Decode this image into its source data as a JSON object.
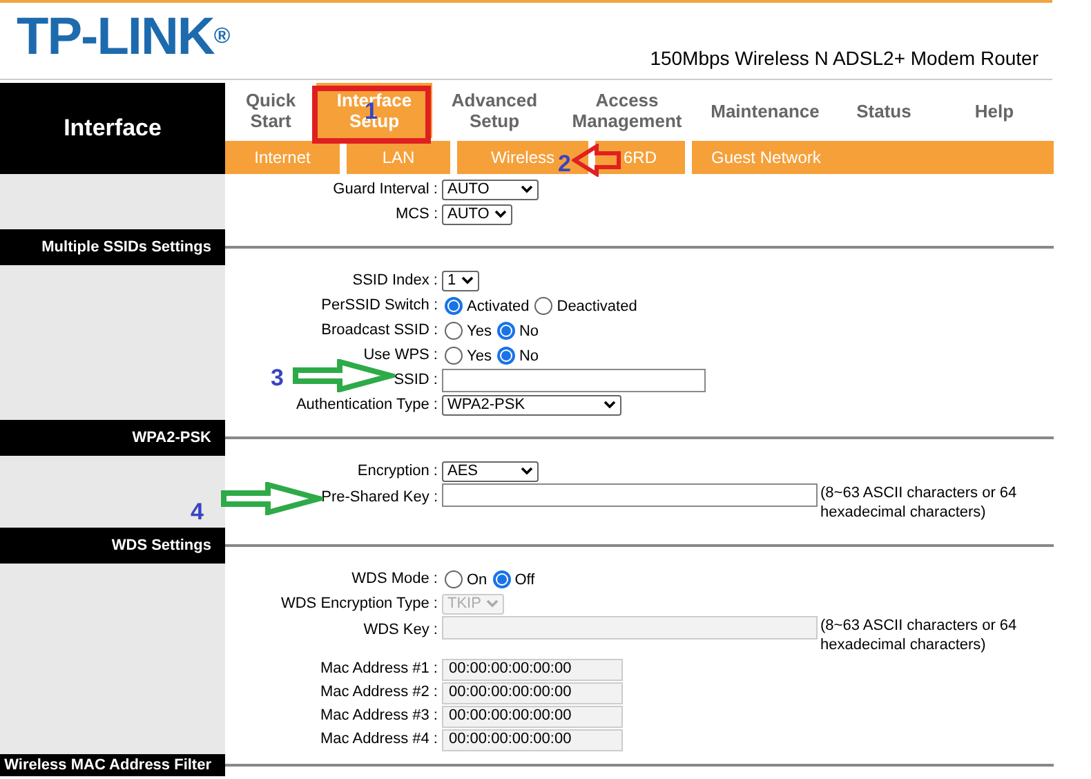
{
  "header": {
    "logo": "TP-LINK",
    "logo_mark": "®",
    "product": "150Mbps Wireless N ADSL2+ Modem Router"
  },
  "nav": {
    "section": "Interface",
    "tabs": [
      {
        "label": "Quick\nStart",
        "selected": false
      },
      {
        "label": "Interface\nSetup",
        "selected": true
      },
      {
        "label": "Advanced\nSetup",
        "selected": false
      },
      {
        "label": "Access\nManagement",
        "selected": false
      },
      {
        "label": "Maintenance",
        "selected": false
      },
      {
        "label": "Status",
        "selected": false
      },
      {
        "label": "Help",
        "selected": false
      }
    ],
    "subtabs": [
      {
        "label": "Internet"
      },
      {
        "label": "LAN"
      },
      {
        "label": "Wireless"
      },
      {
        "label": "6RD"
      },
      {
        "label": "Guest Network"
      }
    ]
  },
  "sections": [
    {
      "rows": [
        {
          "kind": "select",
          "label": "Guard Interval :",
          "value": "AUTO",
          "disabled": false,
          "wide": true
        },
        {
          "kind": "select",
          "label": "MCS :",
          "value": "AUTO",
          "disabled": false
        }
      ]
    },
    {
      "title": "Multiple SSIDs Settings",
      "rows": [
        {
          "kind": "select",
          "label": "SSID Index :",
          "value": "1",
          "disabled": false
        },
        {
          "kind": "radio",
          "label": "PerSSID Switch :",
          "options": [
            {
              "label": "Activated",
              "selected": true
            },
            {
              "label": "Deactivated",
              "selected": false
            }
          ]
        },
        {
          "kind": "radio",
          "label": "Broadcast SSID :",
          "options": [
            {
              "label": "Yes",
              "selected": false
            },
            {
              "label": "No",
              "selected": true
            }
          ]
        },
        {
          "kind": "radio",
          "label": "Use WPS :",
          "options": [
            {
              "label": "Yes",
              "selected": false
            },
            {
              "label": "No",
              "selected": true
            }
          ]
        },
        {
          "kind": "text",
          "label": "SSID :",
          "value": "",
          "disabled": false
        },
        {
          "kind": "select",
          "label": "Authentication Type :",
          "value": "WPA2-PSK",
          "disabled": false,
          "wide": true
        }
      ]
    },
    {
      "title": "WPA2-PSK",
      "rows": [
        {
          "kind": "select",
          "label": "Encryption :",
          "value": "AES",
          "disabled": false,
          "wide": true
        },
        {
          "kind": "key",
          "label": "Pre-Shared Key :",
          "value": "",
          "disabled": false,
          "note": "(8~63 ASCII characters or 64 hexadecimal characters)"
        }
      ]
    },
    {
      "title": "WDS Settings",
      "rows": [
        {
          "kind": "radio",
          "label": "WDS Mode :",
          "options": [
            {
              "label": "On",
              "selected": false
            },
            {
              "label": "Off",
              "selected": true
            }
          ]
        },
        {
          "kind": "select",
          "label": "WDS Encryption Type :",
          "value": "TKIP",
          "disabled": true
        },
        {
          "kind": "key",
          "label": "WDS Key :",
          "value": "",
          "disabled": true,
          "note": "(8~63 ASCII characters or 64 hexadecimal characters)"
        },
        {
          "kind": "mac",
          "label": "Mac Address #1 :",
          "value": "00:00:00:00:00:00",
          "disabled": true
        },
        {
          "kind": "mac",
          "label": "Mac Address #2 :",
          "value": "00:00:00:00:00:00",
          "disabled": true
        },
        {
          "kind": "mac",
          "label": "Mac Address #3 :",
          "value": "00:00:00:00:00:00",
          "disabled": true
        },
        {
          "kind": "mac",
          "label": "Mac Address #4 :",
          "value": "00:00:00:00:00:00",
          "disabled": true
        }
      ]
    },
    {
      "title": "Wireless MAC Address Filter"
    }
  ],
  "annotations": [
    {
      "kind": "box",
      "label": "1"
    },
    {
      "kind": "arrow-left",
      "label": "2"
    },
    {
      "kind": "arrow-right",
      "label": "3"
    },
    {
      "kind": "arrow-right",
      "label": "4"
    }
  ]
}
